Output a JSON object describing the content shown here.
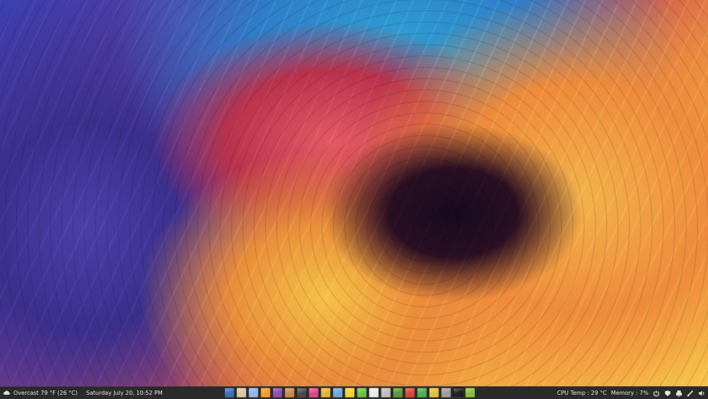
{
  "panel": {
    "weather": {
      "icon": "cloud-icon",
      "text": "Overcast 79 °F (26 °C)"
    },
    "clock": "Saturday July 20, 10:52 PM",
    "dock": [
      {
        "name": "launcher-files",
        "icon": "folder-icon",
        "color": "#3d6fb6"
      },
      {
        "name": "launcher-text-editor",
        "icon": "notepad-icon",
        "color": "#d9c9a0"
      },
      {
        "name": "launcher-music",
        "icon": "music-icon",
        "color": "#8fb6e6"
      },
      {
        "name": "launcher-feed-reader",
        "icon": "rss-icon",
        "color": "#f39b2c"
      },
      {
        "name": "launcher-theme-tool",
        "icon": "paintbrush-icon",
        "color": "#8a4fa6"
      },
      {
        "name": "launcher-image-viewer",
        "icon": "image-icon",
        "color": "#c98d4b"
      },
      {
        "name": "launcher-camera",
        "icon": "camera-icon",
        "color": "#4a4a4a"
      },
      {
        "name": "launcher-color-picker",
        "icon": "palette-icon",
        "color": "#d94a8c"
      },
      {
        "name": "launcher-drawing",
        "icon": "pencil-icon",
        "color": "#e0b33c"
      },
      {
        "name": "launcher-settings",
        "icon": "gear-icon",
        "color": "#6fa8d8"
      },
      {
        "name": "launcher-notes",
        "icon": "sticky-note-icon",
        "color": "#f2d13c"
      },
      {
        "name": "launcher-map",
        "icon": "map-icon",
        "color": "#6cbf4a"
      },
      {
        "name": "launcher-writer",
        "icon": "document-icon",
        "color": "#e8e8e8"
      },
      {
        "name": "launcher-calculator",
        "icon": "calculator-icon",
        "color": "#bdbdbd"
      },
      {
        "name": "launcher-game",
        "icon": "puzzle-icon",
        "color": "#5a9a3a"
      },
      {
        "name": "launcher-media",
        "icon": "play-icon",
        "color": "#d9473a"
      },
      {
        "name": "launcher-software",
        "icon": "package-icon",
        "color": "#4caf50"
      },
      {
        "name": "launcher-system-monitor",
        "icon": "chart-icon",
        "color": "#e0c040"
      },
      {
        "name": "launcher-disks",
        "icon": "disk-icon",
        "color": "#9e9e9e"
      },
      {
        "name": "launcher-terminal",
        "icon": "terminal-icon",
        "color": "#1e1e1e"
      },
      {
        "name": "launcher-mint-menu",
        "icon": "mint-logo-icon",
        "color": "#86be43"
      }
    ],
    "cpu_temp": "CPU Temp : 29 °C",
    "memory": "Memory : 7%",
    "tray": [
      {
        "name": "power-icon"
      },
      {
        "name": "shield-icon"
      },
      {
        "name": "printer-icon"
      },
      {
        "name": "network-icon"
      },
      {
        "name": "volume-icon"
      }
    ]
  }
}
